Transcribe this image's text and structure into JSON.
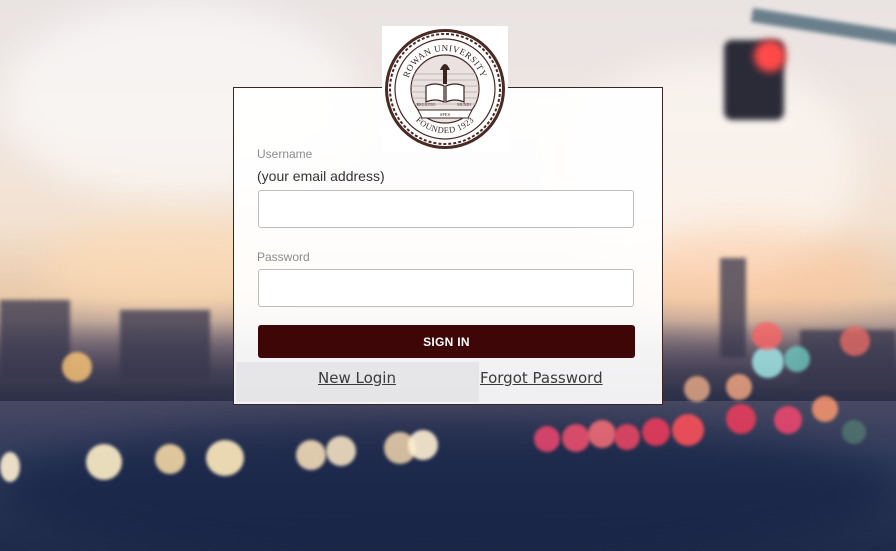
{
  "logo": {
    "top_text": "ROWAN UNIVERSITY",
    "bottom_text": "FOUNDED 1923",
    "ribbon_left": "REGIOTIO",
    "ribbon_center": "SPES",
    "ribbon_right": "MUNDI"
  },
  "form": {
    "username_label": "Username",
    "username_hint": "(your email address)",
    "username_value": "",
    "password_label": "Password",
    "password_value": "",
    "signin_label": "SIGN IN"
  },
  "links": {
    "new_login": "New Login",
    "forgot_password": "Forgot Password"
  },
  "colors": {
    "brand_maroon": "#3f0608",
    "card_border": "#3b2424"
  }
}
